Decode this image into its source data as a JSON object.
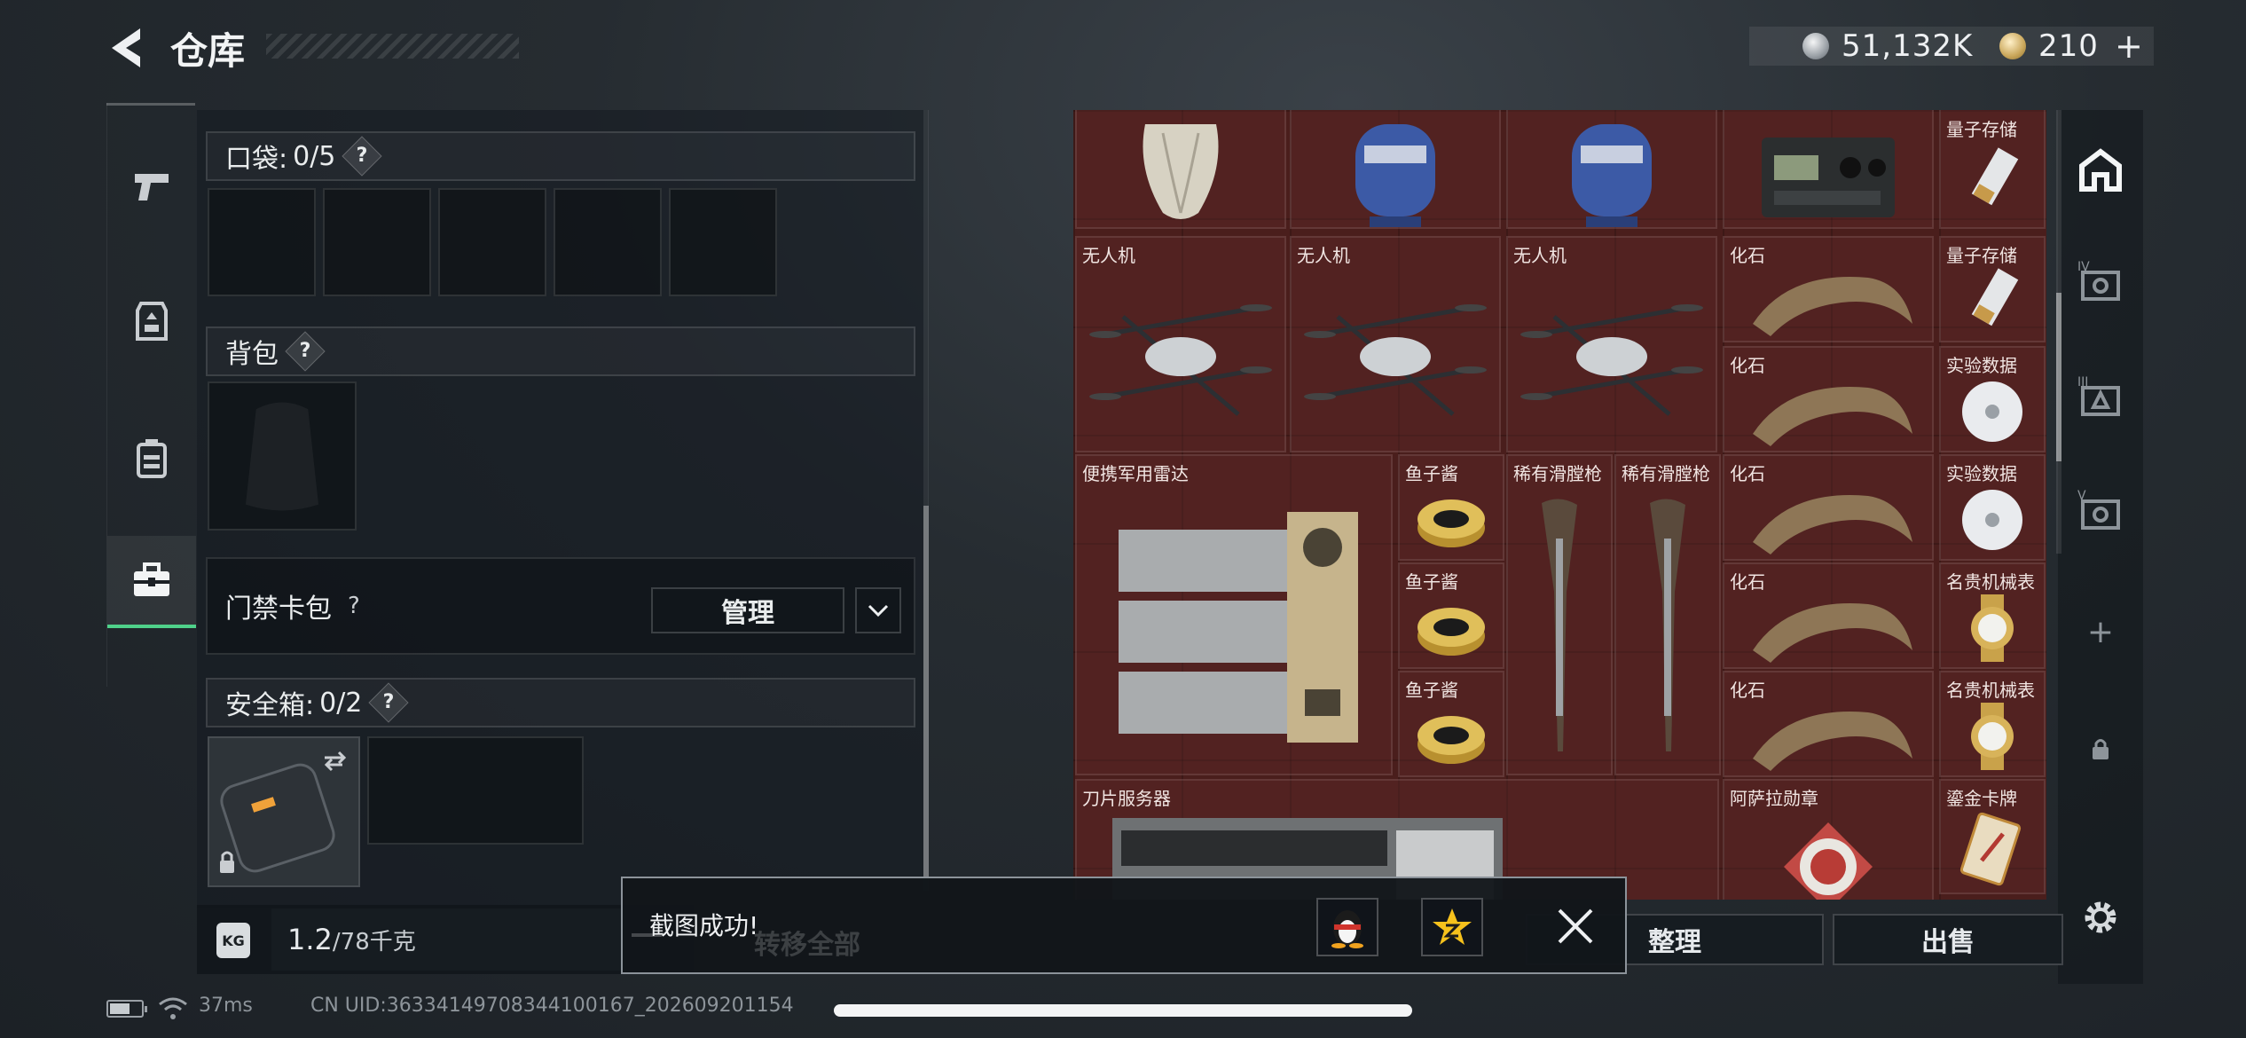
{
  "header": {
    "title": "仓库",
    "silver_amount": "51,132K",
    "gold_amount": "210",
    "gold_plus": "+"
  },
  "left_tabs": [
    {
      "icon": "pistol-icon",
      "active": false
    },
    {
      "icon": "armor-vest-icon",
      "active": false
    },
    {
      "icon": "backpack-tab-icon",
      "active": false
    },
    {
      "icon": "toolbox-icon",
      "active": true
    }
  ],
  "loadout": {
    "pocket": {
      "label": "口袋:",
      "count": "0/5",
      "help": "?"
    },
    "backpack": {
      "label": "背包",
      "help": "?"
    },
    "keycard": {
      "label": "门禁卡包",
      "help": "?",
      "manage_label": "管理"
    },
    "safebox": {
      "label": "安全箱:",
      "count": "0/2",
      "help": "?"
    }
  },
  "weight": {
    "current": "1.2",
    "max": "/78千克",
    "kg_badge": "KG"
  },
  "stash_items": [
    {
      "label": "",
      "icon": "vase-icon"
    },
    {
      "label": "",
      "icon": "gas-canister-icon"
    },
    {
      "label": "",
      "icon": "gas-canister-icon"
    },
    {
      "label": "",
      "icon": "radio-device-icon"
    },
    {
      "label": "量子存储",
      "icon": "usb-drive-icon"
    },
    {
      "label": "无人机",
      "icon": "drone-icon"
    },
    {
      "label": "无人机",
      "icon": "drone-icon"
    },
    {
      "label": "无人机",
      "icon": "drone-icon"
    },
    {
      "label": "化石",
      "icon": "fossil-claw-icon"
    },
    {
      "label": "量子存储",
      "icon": "usb-drive-icon"
    },
    {
      "label": "化石",
      "icon": "fossil-claw-icon"
    },
    {
      "label": "实验数据",
      "icon": "disc-icon"
    },
    {
      "label": "便携军用雷达",
      "icon": "radar-icon"
    },
    {
      "label": "鱼子酱",
      "icon": "caviar-tin-icon"
    },
    {
      "label": "稀有滑膛枪",
      "icon": "musket-icon"
    },
    {
      "label": "稀有滑膛枪",
      "icon": "musket-icon"
    },
    {
      "label": "化石",
      "icon": "fossil-claw-icon"
    },
    {
      "label": "实验数据",
      "icon": "disc-icon"
    },
    {
      "label": "鱼子酱",
      "icon": "caviar-tin-icon"
    },
    {
      "label": "化石",
      "icon": "fossil-claw-icon"
    },
    {
      "label": "名贵机械表",
      "icon": "watch-icon"
    },
    {
      "label": "鱼子酱",
      "icon": "caviar-tin-icon"
    },
    {
      "label": "化石",
      "icon": "fossil-claw-icon"
    },
    {
      "label": "名贵机械表",
      "icon": "watch-icon"
    },
    {
      "label": "刀片服务器",
      "icon": "server-icon"
    },
    {
      "label": "阿萨拉勋章",
      "icon": "medal-icon"
    },
    {
      "label": "鎏金卡牌",
      "icon": "card-icon"
    }
  ],
  "right_rail": {
    "labels": [
      "IV",
      "III",
      "V"
    ],
    "add": "+"
  },
  "actions": {
    "transfer_all": "转移全部",
    "sort": "整理",
    "sell": "出售"
  },
  "toast": {
    "message": "截图成功!",
    "share_qq": "qq-penguin-icon",
    "share_qzone": "qzone-star-icon"
  },
  "status": {
    "ping": "37ms",
    "uid": "CN UID:3633414970834410016​7_202609201154"
  },
  "colors": {
    "stash_bg": "#4a1e1c",
    "active_tab": "#4fd18a",
    "panel_bg": "#1c2126"
  }
}
